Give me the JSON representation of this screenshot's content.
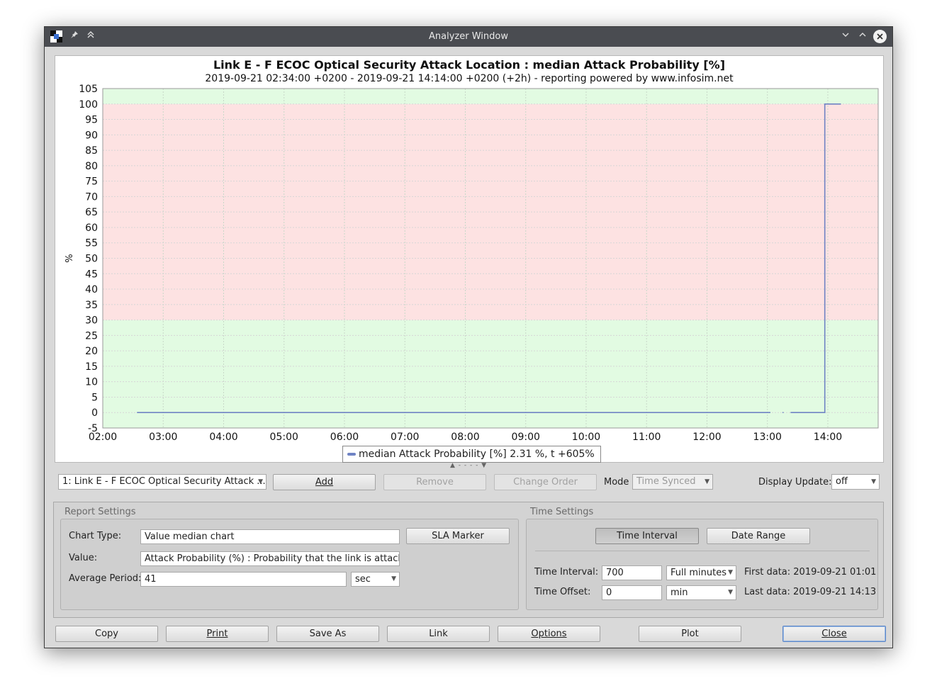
{
  "window": {
    "title": "Analyzer Window",
    "controls": {
      "minimize": "⌄",
      "maximize": "⌃",
      "close": "✕",
      "pin": "📌",
      "keep_above": "⌃⌃"
    }
  },
  "chart_data": {
    "type": "line",
    "title": "Link E - F ECOC Optical Security Attack Location : median Attack Probability [%]",
    "subtitle": "2019-09-21 02:34:00 +0200 - 2019-09-21 14:14:00 +0200 (+2h) - reporting powered by www.infosim.net",
    "ylabel": "%",
    "xlabel": "",
    "x_ticks": [
      "02:00",
      "03:00",
      "04:00",
      "05:00",
      "06:00",
      "07:00",
      "08:00",
      "09:00",
      "10:00",
      "11:00",
      "12:00",
      "13:00",
      "14:00"
    ],
    "y_ticks": [
      -5,
      0,
      5,
      10,
      15,
      20,
      25,
      30,
      35,
      40,
      45,
      50,
      55,
      60,
      65,
      70,
      75,
      80,
      85,
      90,
      95,
      100,
      105
    ],
    "xlim": [
      "02:00",
      "14:50"
    ],
    "ylim": [
      -5,
      105
    ],
    "grid": true,
    "bands": [
      {
        "from": -5,
        "to": 30,
        "color": "#e2fbe2"
      },
      {
        "from": 30,
        "to": 100,
        "color": "#fde2e2"
      },
      {
        "from": 100,
        "to": 105,
        "color": "#e2fbe2"
      }
    ],
    "series": [
      {
        "name": "median Attack Probability [%]",
        "color": "#6f83c4",
        "segments": [
          [
            [
              "02:34",
              0
            ],
            [
              "13:03",
              0
            ]
          ],
          [
            [
              "13:15",
              0
            ],
            [
              "13:16",
              0
            ]
          ],
          [
            [
              "13:23",
              0
            ],
            [
              "13:57",
              0
            ],
            [
              "13:57",
              100
            ],
            [
              "14:13",
              100
            ]
          ]
        ]
      }
    ],
    "legend": {
      "placement": "bottom-center",
      "text": "median Attack Probability [%] 2.31 %, t +605%"
    }
  },
  "toolbar": {
    "chart_select": "1: Link E - F ECOC Optical Security Attack ...",
    "add": "Add",
    "remove": "Remove",
    "change_order": "Change Order",
    "mode_label": "Mode",
    "mode_value": "Time Synced",
    "display_update_label": "Display Update:",
    "display_update_value": "off"
  },
  "report_settings": {
    "title": "Report Settings",
    "chart_type_label": "Chart Type:",
    "chart_type_value": "Value median chart",
    "sla_marker": "SLA Marker",
    "value_label": "Value:",
    "value_value": "Attack Probability (%) : Probability that the link is attacked",
    "average_period_label": "Average Period:",
    "average_period_value": "41",
    "average_period_unit": "sec"
  },
  "time_settings": {
    "title": "Time Settings",
    "time_interval_button": "Time Interval",
    "date_range_button": "Date Range",
    "time_interval_label": "Time Interval:",
    "time_interval_value": "700",
    "time_interval_unit": "Full minutes",
    "time_offset_label": "Time Offset:",
    "time_offset_value": "0",
    "time_offset_unit": "min",
    "first_data": "First data: 2019-09-21 01:01",
    "last_data": "Last data: 2019-09-21 14:13"
  },
  "bottom_buttons": {
    "copy": "Copy",
    "print": "Print",
    "save_as": "Save As",
    "link": "Link",
    "options": "Options",
    "plot": "Plot",
    "close": "Close"
  }
}
